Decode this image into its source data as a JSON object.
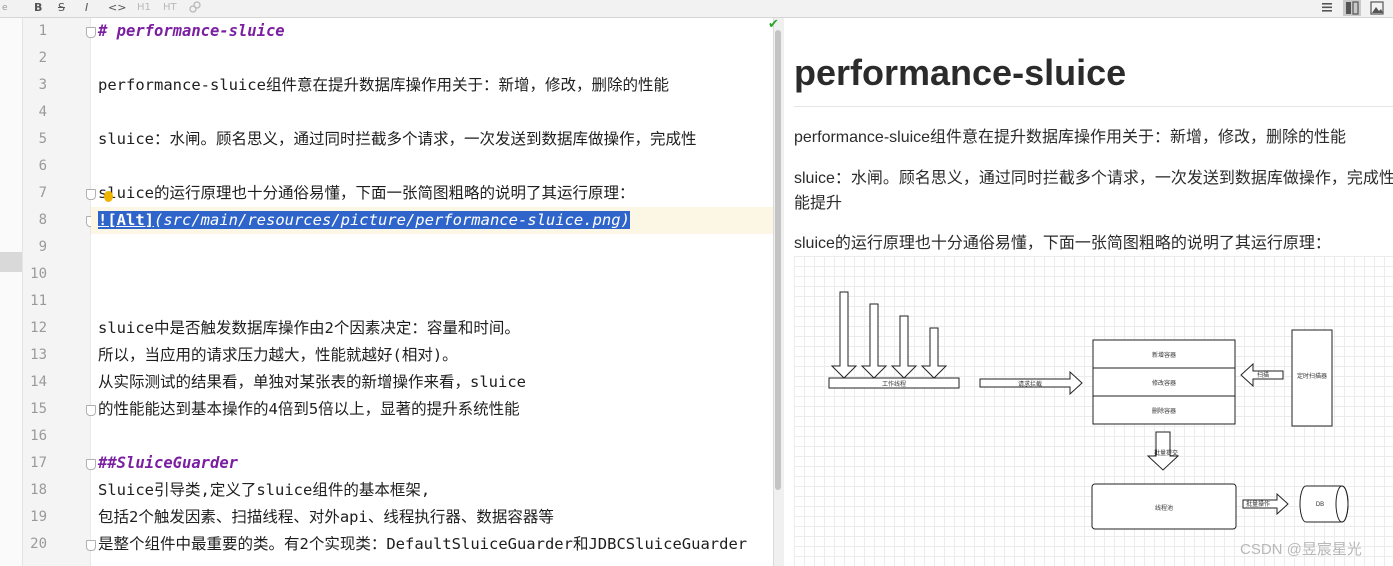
{
  "toolbar": {
    "bold_label": "B",
    "strike_label": "S",
    "italic_label": "I",
    "code_label": "<>",
    "h1_label": "H1",
    "h_label": "HT"
  },
  "editor": {
    "lines": [
      {
        "num": "1",
        "text": "# performance-sluice"
      },
      {
        "num": "2",
        "text": ""
      },
      {
        "num": "3",
        "text": "performance-sluice组件意在提升数据库操作用关于：新增，修改，删除的性能"
      },
      {
        "num": "4",
        "text": ""
      },
      {
        "num": "5",
        "text": "sluice：水闸。顾名思义，通过同时拦截多个请求，一次发送到数据库做操作，完成性"
      },
      {
        "num": "6",
        "text": ""
      },
      {
        "num": "7",
        "text": "sluice的运行原理也十分通俗易懂，下面一张简图粗略的说明了其运行原理："
      },
      {
        "num": "8",
        "text": "![Alt](src/main/resources/picture/performance-sluice.png)"
      },
      {
        "num": "9",
        "text": ""
      },
      {
        "num": "10",
        "text": ""
      },
      {
        "num": "11",
        "text": ""
      },
      {
        "num": "12",
        "text": "sluice中是否触发数据库操作由2个因素决定：容量和时间。"
      },
      {
        "num": "13",
        "text": "所以，当应用的请求压力越大，性能就越好(相对)。"
      },
      {
        "num": "14",
        "text": "从实际测试的结果看，单独对某张表的新增操作来看，sluice"
      },
      {
        "num": "15",
        "text": "的性能能达到基本操作的4倍到5倍以上，显著的提升系统性能"
      },
      {
        "num": "16",
        "text": ""
      },
      {
        "num": "17",
        "text": "##SluiceGuarder"
      },
      {
        "num": "18",
        "text": "Sluice引导类,定义了sluice组件的基本框架,"
      },
      {
        "num": "19",
        "text": "包括2个触发因素、扫描线程、对外api、线程执行器、数据容器等"
      },
      {
        "num": "20",
        "text": "是整个组件中最重要的类。有2个实现类：DefaultSluiceGuarder和JDBCSluiceGuarder"
      }
    ],
    "link_alt": "![Alt]",
    "link_path": "(src/main/resources/picture/performance-sluice.png)"
  },
  "preview": {
    "title": "performance-sluice",
    "para1": "performance-sluice组件意在提升数据库操作用关于：新增，修改，删除的性能",
    "para2_line1": "sluice：水闸。顾名思义，通过同时拦截多个请求，一次发送到数据库做操作，完成性",
    "para2_line2": "能提升",
    "para3": "sluice的运行原理也十分通俗易懂，下面一张简图粗略的说明了其运行原理：",
    "diagram": {
      "label_pool": "工作线程",
      "label_arrow1": "请求拦截",
      "box_add": "新增容器",
      "box_update": "修改容器",
      "box_delete": "删除容器",
      "scan_label": "扫描",
      "timer_box": "定时扫描器",
      "arrow_down_label": "批量提交",
      "executor_box": "线程池",
      "batch_label": "批量操作",
      "db_label": "DB"
    }
  },
  "watermark": "CSDN @昱宸星光"
}
